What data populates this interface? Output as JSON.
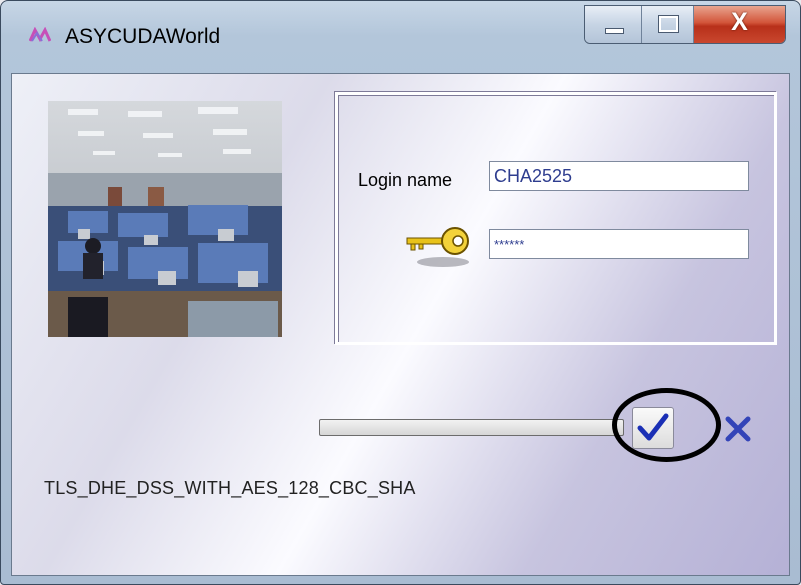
{
  "window": {
    "title": "ASYCUDAWorld",
    "controls": {
      "minimize": "minimize-icon",
      "maximize": "maximize-icon",
      "close_glyph": "X"
    }
  },
  "login": {
    "login_name_label": "Login name",
    "login_name_value": "CHA2525",
    "password_value": "******",
    "password_icon": "key-icon"
  },
  "progress": {
    "fraction": 0
  },
  "actions": {
    "ok_icon": "checkmark-icon",
    "cancel_icon": "cross-icon"
  },
  "status": {
    "cipher_suite": "TLS_DHE_DSS_WITH_AES_128_CBC_SHA"
  },
  "colors": {
    "accent_blue": "#1a2fb5",
    "title_bar": "#b3c6da",
    "close_red": "#c9472e"
  }
}
